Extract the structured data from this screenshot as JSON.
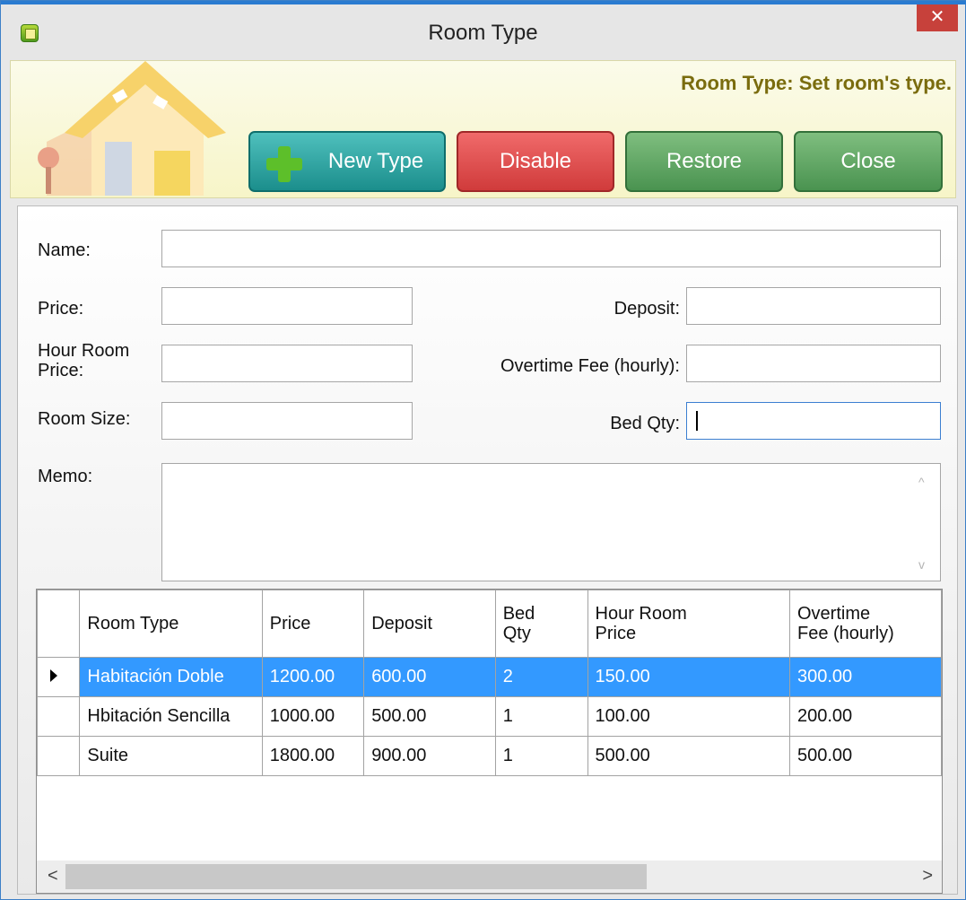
{
  "window": {
    "title": "Room Type",
    "close_glyph": "✕"
  },
  "banner": {
    "hint": "Room Type: Set room's type."
  },
  "toolbar": {
    "new_label": "New Type",
    "disable_label": "Disable",
    "restore_label": "Restore",
    "close_label": "Close"
  },
  "form": {
    "name_label": "Name:",
    "price_label": "Price:",
    "deposit_label": "Deposit:",
    "hour_price_label_1": "Hour Room",
    "hour_price_label_2": "Price:",
    "overtime_label": "Overtime Fee (hourly):",
    "room_size_label": "Room Size:",
    "bed_qty_label": "Bed Qty:",
    "memo_label": "Memo:",
    "name_value": "",
    "price_value": "",
    "deposit_value": "",
    "hour_price_value": "",
    "overtime_value": "",
    "room_size_value": "",
    "bed_qty_value": ""
  },
  "table": {
    "columns": [
      {
        "line1": "Room Type",
        "line2": ""
      },
      {
        "line1": "Price",
        "line2": ""
      },
      {
        "line1": "Deposit",
        "line2": ""
      },
      {
        "line1": "Bed",
        "line2": "Qty"
      },
      {
        "line1": "Hour Room",
        "line2": "Price"
      },
      {
        "line1": "Overtime",
        "line2": "Fee (hourly)"
      }
    ],
    "rows": [
      [
        "Habitación Doble",
        "1200.00",
        "600.00",
        "2",
        "150.00",
        "300.00"
      ],
      [
        "Hbitación Sencilla",
        "1000.00",
        "500.00",
        "1",
        "100.00",
        "200.00"
      ],
      [
        "Suite",
        "1800.00",
        "900.00",
        "1",
        "500.00",
        "500.00"
      ]
    ],
    "selected_row": 0
  },
  "scrollbar": {
    "left_glyph": "<",
    "right_glyph": ">",
    "up_glyph": "^",
    "down_glyph": "v"
  },
  "colors": {
    "selection": "#3399ff",
    "accent": "#2a7bd0",
    "banner_text": "#7a6c0e"
  }
}
